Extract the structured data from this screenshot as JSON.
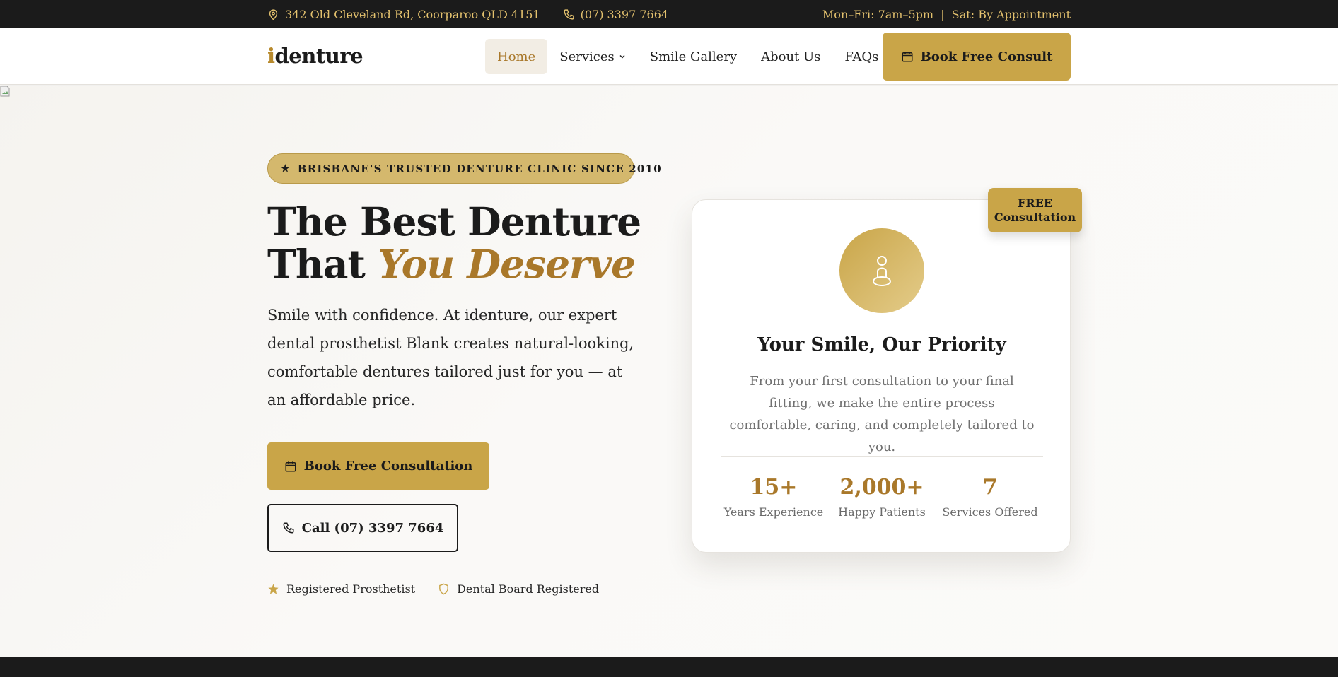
{
  "topbar": {
    "address_icon": "map-pin-icon",
    "address": "342 Old Cleveland Rd, Coorparoo QLD 4151",
    "phone_icon": "phone-icon",
    "phone": "(07) 3397 7664",
    "hours": "Mon–Fri: 7am–5pm  |  Sat: By Appointment"
  },
  "nav": {
    "logo_accent": "i",
    "logo_rest": "denture",
    "items": [
      {
        "label": "Home",
        "active": true
      },
      {
        "label": "Services",
        "has_dropdown": true
      },
      {
        "label": "Smile Gallery"
      },
      {
        "label": "About Us"
      },
      {
        "label": "FAQs"
      }
    ],
    "cta_label": "Book Free Consult",
    "cta_icon": "calendar-icon"
  },
  "hero": {
    "badge": "BRISBANE'S TRUSTED DENTURE CLINIC SINCE 2010",
    "badge_icon": "star-icon",
    "title_line1": "The Best Denture",
    "title_line2_plain": "That ",
    "title_line2_accent": "You Deserve",
    "lead": "Smile with confidence. At identure, our expert dental prosthetist Blank creates natural-looking, comfortable dentures tailored just for you — at an affordable price.",
    "primary_button": "Book Free Consultation",
    "secondary_button": "Call (07) 3397 7664",
    "trust": [
      {
        "icon": "star-icon",
        "label": "Registered Prosthetist"
      },
      {
        "icon": "shield-icon",
        "label": "Dental Board Registered"
      }
    ]
  },
  "card": {
    "tag_line1": "FREE",
    "tag_line2": "Consultation",
    "icon": "person-icon",
    "title": "Your Smile, Our Priority",
    "text": "From your first consultation to your final fitting, we make the entire process comfortable, caring, and completely tailored to you.",
    "stats": [
      {
        "value": "15+",
        "label": "Years Experience"
      },
      {
        "value": "2,000+",
        "label": "Happy Patients"
      },
      {
        "value": "7",
        "label": "Services Offered"
      }
    ]
  },
  "colors": {
    "gold": "#c9a548",
    "gold_text": "#a9782a",
    "dark": "#1b1b1b",
    "topbar_text": "#e3c16e"
  }
}
